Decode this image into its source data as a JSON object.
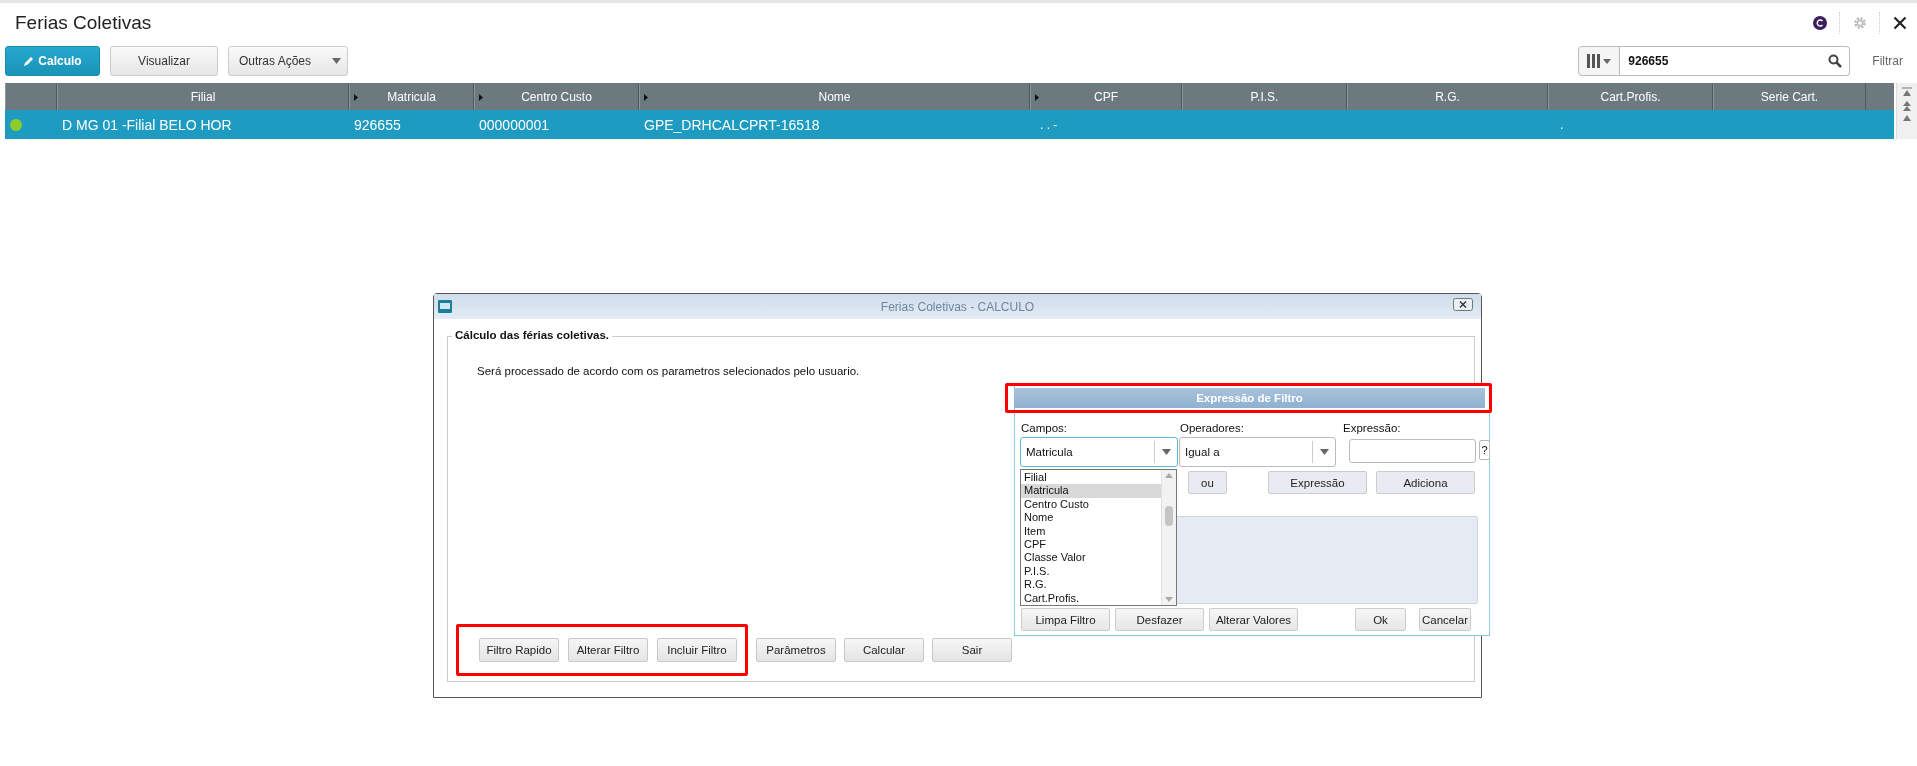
{
  "page": {
    "title": "Ferias Coletivas"
  },
  "toolbar": [
    {
      "label": "Calculo",
      "kind": "primary"
    },
    {
      "label": "Visualizar",
      "kind": "plain"
    },
    {
      "label": "Outras Ações",
      "kind": "menu"
    }
  ],
  "search": {
    "value": "926655",
    "filter_label": "Filtrar"
  },
  "table": {
    "columns": [
      {
        "label": "Filial",
        "indicator": false
      },
      {
        "label": "Matricula",
        "indicator": true
      },
      {
        "label": "Centro Custo",
        "indicator": true
      },
      {
        "label": "Nome",
        "indicator": true
      },
      {
        "label": "CPF",
        "indicator": true
      },
      {
        "label": "P.I.S.",
        "indicator": false
      },
      {
        "label": "R.G.",
        "indicator": false
      },
      {
        "label": "Cart.Profis.",
        "indicator": false
      },
      {
        "label": "Serie Cart.",
        "indicator": false
      }
    ],
    "rows": [
      {
        "selected": true,
        "color": "#8ccc2a",
        "cells": [
          "D MG 01 -Filial BELO HOR",
          "926655",
          "000000001",
          "GPE_DRHCALCPRT-16518",
          ". . -",
          null,
          null,
          ".",
          null
        ]
      }
    ]
  },
  "calc_dialog": {
    "title": "Ferias Coletivas - CALCULO",
    "group_title": "Cálculo das férias coletivas.",
    "message": "Será processado de acordo com os parametros selecionados pelo usuario.",
    "buttons": [
      {
        "label": "Filtro Rapido",
        "highlighted": true
      },
      {
        "label": "Alterar Filtro",
        "highlighted": true
      },
      {
        "label": "Incluir Filtro",
        "highlighted": true
      },
      {
        "label": "Parâmetros",
        "highlighted": false
      },
      {
        "label": "Calcular",
        "highlighted": false
      },
      {
        "label": "Sair",
        "highlighted": false
      }
    ]
  },
  "filter_dialog": {
    "title": "Expressão de Filtro",
    "highlighted": true,
    "campos": {
      "label": "Campos:",
      "value": "Matricula",
      "expanded": true,
      "options": [
        {
          "label": "Filial",
          "selected": false
        },
        {
          "label": "Matricula",
          "selected": true
        },
        {
          "label": "Centro Custo",
          "selected": false
        },
        {
          "label": "Nome",
          "selected": false
        },
        {
          "label": "Item",
          "selected": false
        },
        {
          "label": "CPF",
          "selected": false
        },
        {
          "label": "Classe Valor",
          "selected": false
        },
        {
          "label": "P.I.S.",
          "selected": false
        },
        {
          "label": "R.G.",
          "selected": false
        },
        {
          "label": "Cart.Profis.",
          "selected": false
        }
      ]
    },
    "operadores": {
      "label": "Operadores:",
      "value": "Igual a"
    },
    "expressao": {
      "label": "Expressão:",
      "help": "?"
    },
    "buttons": [
      "ou",
      "Expressão",
      "Adiciona"
    ],
    "bottom_buttons": [
      {
        "label": "Limpa Filtro",
        "kind": "edit"
      },
      {
        "label": "Desfazer",
        "kind": "edit"
      },
      {
        "label": "Alterar Valores",
        "kind": "edit"
      },
      {
        "label": "Ok",
        "kind": "confirm"
      },
      {
        "label": "Cancelar",
        "kind": "confirm"
      }
    ]
  }
}
